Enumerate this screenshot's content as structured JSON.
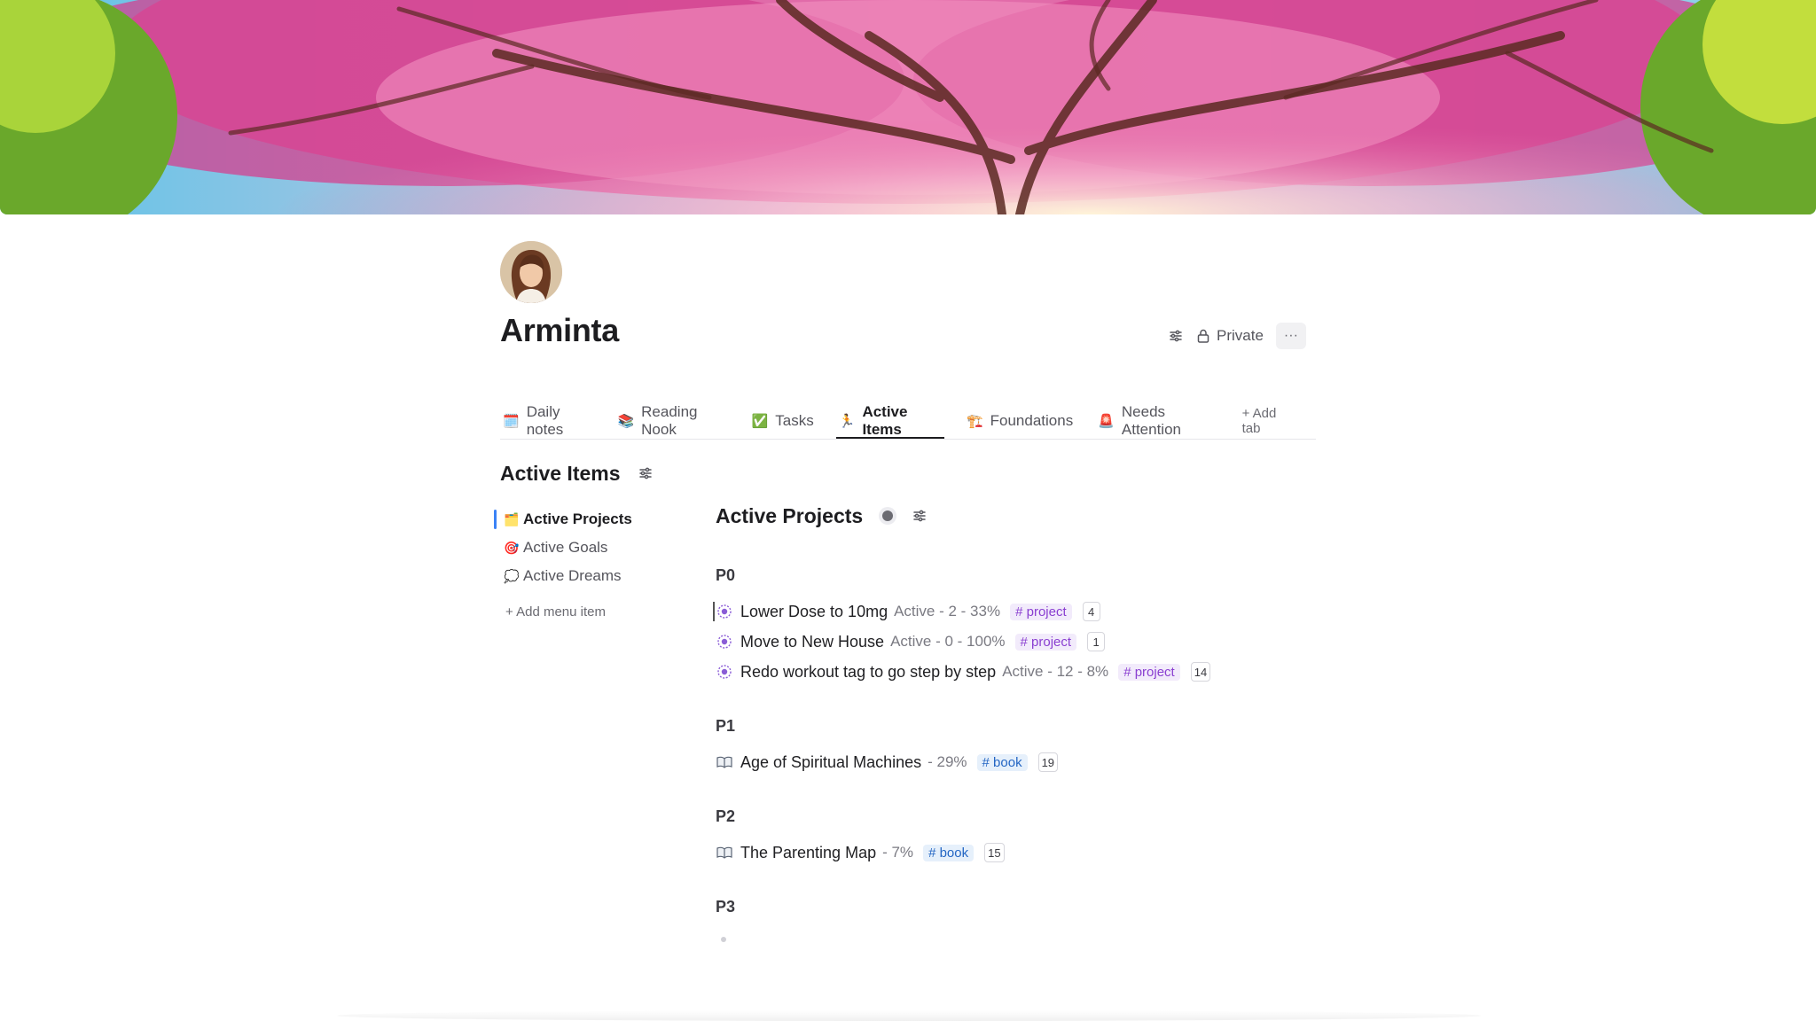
{
  "page": {
    "title": "Arminta",
    "privacy_label": "Private",
    "more_label": "···"
  },
  "tabs": [
    {
      "label": "Daily notes",
      "emoji": "🗓️",
      "active": false
    },
    {
      "label": "Reading Nook",
      "emoji": "📚",
      "active": false
    },
    {
      "label": "Tasks",
      "emoji": "✅",
      "active": false
    },
    {
      "label": "Active Items",
      "emoji": "🏃",
      "active": true
    },
    {
      "label": "Foundations",
      "emoji": "🏗️",
      "active": false
    },
    {
      "label": "Needs Attention",
      "emoji": "🚨",
      "active": false
    }
  ],
  "add_tab_label": "+ Add tab",
  "section": {
    "title": "Active Items"
  },
  "menu": {
    "items": [
      {
        "label": "Active Projects",
        "emoji": "🗂️",
        "active": true
      },
      {
        "label": "Active Goals",
        "emoji": "🎯",
        "active": false
      },
      {
        "label": "Active Dreams",
        "emoji": "💭",
        "active": false
      }
    ],
    "add_label": "+ Add menu item"
  },
  "content": {
    "title": "Active Projects",
    "groups": [
      {
        "label": "P0",
        "items": [
          {
            "title": "Lower Dose to 10mg",
            "meta": "Active - 2 - 33%",
            "tag": "# project",
            "count": "4",
            "icon": "project-icon"
          },
          {
            "title": "Move to New House",
            "meta": "Active - 0 - 100%",
            "tag": "# project",
            "count": "1",
            "icon": "project-icon"
          },
          {
            "title": "Redo workout tag to go step by step",
            "meta": "Active - 12 - 8%",
            "tag": "# project",
            "count": "14",
            "icon": "project-icon"
          }
        ]
      },
      {
        "label": "P1",
        "items": [
          {
            "title": "Age of Spiritual Machines",
            "meta": "- 29%",
            "tag": "# book",
            "count": "19",
            "icon": "book-icon"
          }
        ]
      },
      {
        "label": "P2",
        "items": [
          {
            "title": "The Parenting Map",
            "meta": "- 7%",
            "tag": "# book",
            "count": "15",
            "icon": "book-icon"
          }
        ]
      },
      {
        "label": "P3",
        "items": []
      }
    ]
  },
  "colors": {
    "accent": "#3b82f6",
    "project_tag_bg": "#f2ebfb",
    "project_tag_text": "#8a3fd1",
    "book_tag_bg": "#e6f0fb",
    "book_tag_text": "#2466c4"
  }
}
